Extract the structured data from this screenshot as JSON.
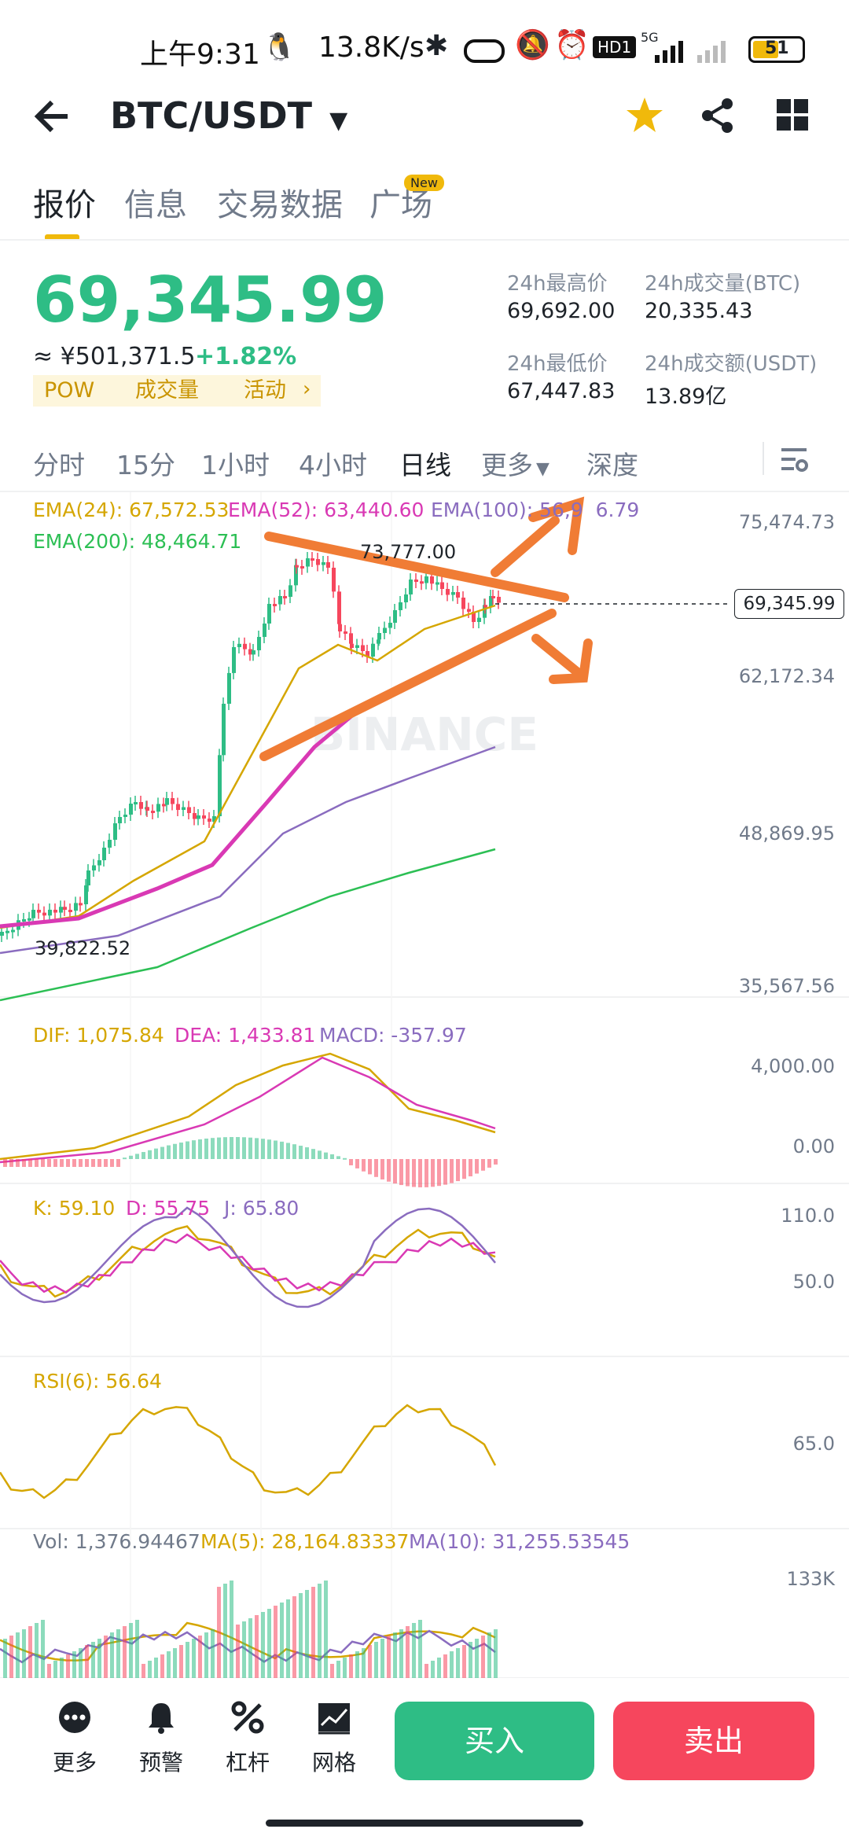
{
  "status_bar": {
    "time": "上午9:31",
    "speed": "13.8K/s",
    "network": "5G",
    "hd": "HD1",
    "battery": "51"
  },
  "header": {
    "title": "BTC/USDT"
  },
  "tabs": [
    {
      "label": "报价"
    },
    {
      "label": "信息"
    },
    {
      "label": "交易数据"
    },
    {
      "label": "广场",
      "badge": "New"
    }
  ],
  "price": {
    "last": "69,345.99",
    "cny": "≈ ¥501,371.5",
    "change": "+1.82%",
    "tags": [
      "POW",
      "成交量",
      "活动"
    ]
  },
  "stats": {
    "high_label": "24h最高价",
    "high": "69,692.00",
    "vol_btc_label": "24h成交量(BTC)",
    "vol_btc": "20,335.43",
    "low_label": "24h最低价",
    "low": "67,447.83",
    "vol_usdt_label": "24h成交额(USDT)",
    "vol_usdt": "13.89亿"
  },
  "intervals": [
    "分时",
    "15分",
    "1小时",
    "4小时",
    "日线",
    "更多",
    "深度"
  ],
  "selected_interval": "日线",
  "main_chart": {
    "ema24": "EMA(24): 67,572.53",
    "ema52": "EMA(52): 63,440.60",
    "ema100": "EMA(100): 56,9",
    "ema100_tail": "6.79",
    "ema200": "EMA(200): 48,464.71",
    "peak_label": "73,777.00",
    "low_label": "39,822.52",
    "current": "69,345.99",
    "axis": [
      "75,474.73",
      "62,172.34",
      "48,869.95",
      "35,567.56"
    ],
    "watermark": "BINANCE"
  },
  "macd": {
    "dif": "DIF: 1,075.84",
    "dea": "DEA: 1,433.81",
    "macd": "MACD: -357.97",
    "axis": [
      "4,000.00",
      "0.00"
    ]
  },
  "kdj": {
    "k": "K: 59.10",
    "d": "D: 55.75",
    "j": "J: 65.80",
    "axis": [
      "110.0",
      "50.0"
    ]
  },
  "rsi": {
    "rsi": "RSI(6): 56.64",
    "axis": [
      "65.0"
    ]
  },
  "volume": {
    "vol": "Vol: 1,376.94467",
    "ma5": "MA(5): 28,164.83337",
    "ma10": "MA(10): 31,255.53545",
    "axis": [
      "133K"
    ]
  },
  "bottom_bar": {
    "more": "更多",
    "alert": "预警",
    "leverage": "杠杆",
    "grid": "网格",
    "buy": "买入",
    "sell": "卖出"
  },
  "colors": {
    "up": "#2ebd85",
    "down": "#f6465d",
    "accent": "#f0b90b",
    "annotation": "#f07c35"
  }
}
